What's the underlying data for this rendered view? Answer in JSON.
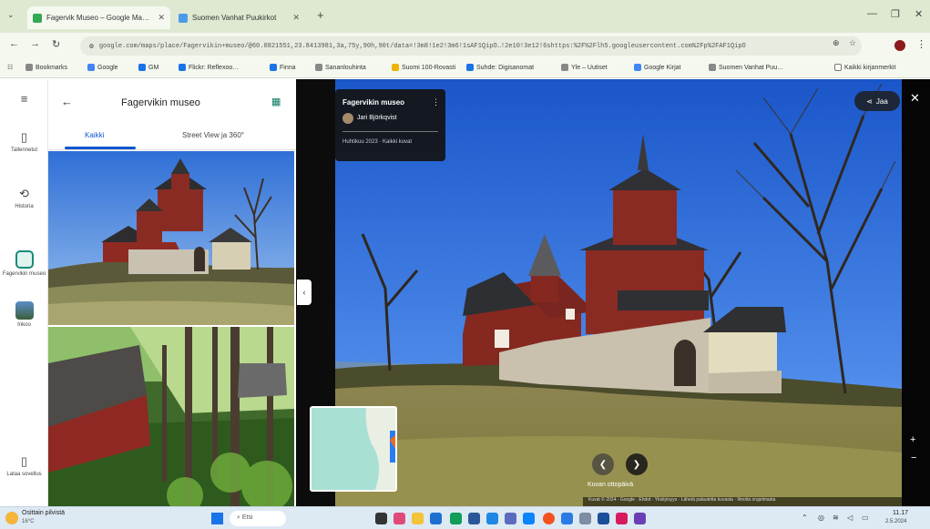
{
  "browser": {
    "tabs": [
      {
        "title": "Fagervik Museo – Google Ma…",
        "active": true,
        "favicon_color": "#34a853"
      },
      {
        "title": "Suomen Vanhat Puukirkot",
        "active": false,
        "favicon_color": "#4d9be8"
      }
    ],
    "new_tab": "+",
    "address": "google.com/maps/place/Fagervikin+museo/@60.0821551,23.8413981,3a,75y,90h,90t/data=!3m8!1e2!3m6!1sAF1QipO…!2e10!3e12!6shttps:%2F%2Flh5.googleusercontent.com%2Fp%2FAF1QipO",
    "bookmarks": [
      {
        "label": "Bookmarks",
        "color": "#888888"
      },
      {
        "label": "Google",
        "color": "#4285f4"
      },
      {
        "label": "GM",
        "color": "#1a73e8"
      },
      {
        "label": "Flickr: Reflexoo…",
        "color": "#1a73e8"
      },
      {
        "label": "Finna",
        "color": "#1a73e8"
      },
      {
        "label": "Sananlouhinta",
        "color": "#888888"
      },
      {
        "label": "Suomi 100-Rovasti",
        "color": "#f2b203"
      },
      {
        "label": "Suhde: Digisanomat",
        "color": "#1a73e8"
      },
      {
        "label": "Yle – Uutiset",
        "color": "#888888"
      },
      {
        "label": "Google Kirjat",
        "color": "#4285f4"
      },
      {
        "label": "Suomen Vanhat Puu…",
        "color": "#888888"
      }
    ],
    "all_bookmarks": "Kaikki kirjanmerkit"
  },
  "rail": [
    {
      "label": "Tallennetut",
      "icon": "bookmark-icon"
    },
    {
      "label": "Historia",
      "icon": "history-icon"
    },
    {
      "label": "Fagervikin museo",
      "icon": "place-icon"
    },
    {
      "label": "Inkoo",
      "icon": "thumbnail-icon"
    },
    {
      "label": "Lataa sovellus",
      "icon": "phone-icon"
    }
  ],
  "panel": {
    "title": "Fagervikin museo",
    "tabs": [
      "Kaikki",
      "Street View ja 360°"
    ]
  },
  "street_view": {
    "place_title": "Fagervikin museo",
    "author": "Jari Björkqvist",
    "date_line": "Huhtikuu 2023 · Kaikki kuvat",
    "share_label": "Jaa",
    "photo_date": "Kuvan ottopäivä",
    "attribution": "Kuvat © 2024 · Google · Ehdot · Yksityisyys · Lähetä palautetta kuvasta · Ilmoita ongelmasta"
  },
  "taskbar": {
    "weather": "Osittain pilvistä",
    "weather_sub": "16°C",
    "search_label": "Etsi",
    "time": "11.17",
    "date": "2.5.2024"
  }
}
